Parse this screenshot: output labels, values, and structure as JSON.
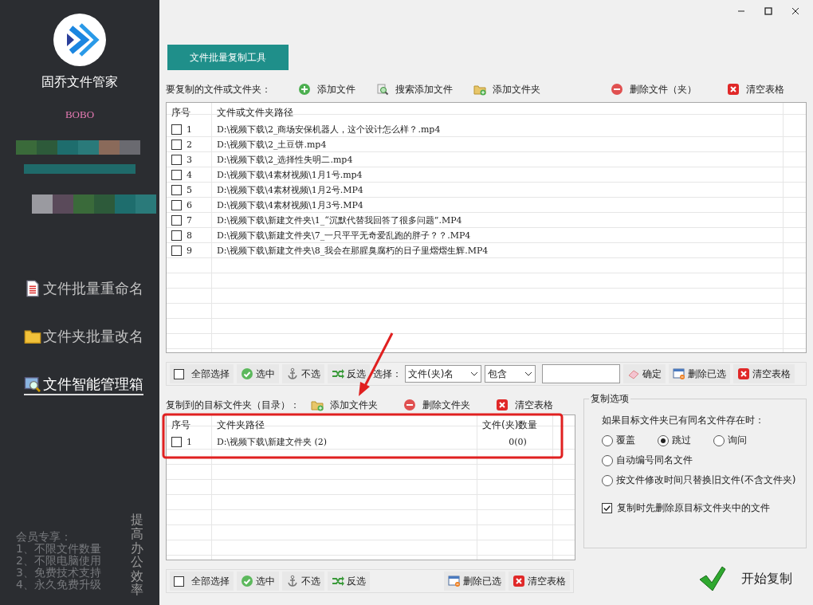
{
  "sidebar": {
    "app_name": "固乔文件管家",
    "user": "BOBO",
    "nav_items": [
      {
        "label": "文件批量重命名",
        "selected": false
      },
      {
        "label": "文件夹批量改名",
        "selected": false
      },
      {
        "label": "文件智能管理箱",
        "selected": true
      }
    ],
    "promo_title": "会员专享：",
    "promo_lines": [
      "1、不限文件数量",
      "2、不限电脑使用",
      "3、免费技术支持",
      "4、永久免费升级"
    ],
    "slogan": "提高办公效率"
  },
  "tab": {
    "label": "文件批量复制工具",
    "selected": true
  },
  "source": {
    "label": "要复制的文件或文件夹：",
    "actions": [
      "添加文件",
      "搜索添加文件",
      "添加文件夹",
      "删除文件（夹）",
      "清空表格"
    ],
    "table": {
      "columns": [
        "序号",
        "文件或文件夹路径"
      ],
      "rows": [
        {
          "index": "1",
          "path": "D:\\视频下载\\2_商场安保机器人，这个设计怎么样？.mp4",
          "checked": false
        },
        {
          "index": "2",
          "path": "D:\\视频下载\\2_土豆饼.mp4",
          "checked": false
        },
        {
          "index": "3",
          "path": "D:\\视频下载\\2_选择性失明二.mp4",
          "checked": false
        },
        {
          "index": "4",
          "path": "D:\\视频下载\\4素材视频\\1月1号.mp4",
          "checked": false
        },
        {
          "index": "5",
          "path": "D:\\视频下载\\4素材视频\\1月2号.MP4",
          "checked": false
        },
        {
          "index": "6",
          "path": "D:\\视频下载\\4素材视频\\1月3号.MP4",
          "checked": false
        },
        {
          "index": "7",
          "path": "D:\\视频下载\\新建文件夹\\1_“沉默代替我回答了很多问题”.MP4",
          "checked": false
        },
        {
          "index": "8",
          "path": "D:\\视频下载\\新建文件夹\\7_一只平平无奇爱乱跑的胖子？？.MP4",
          "checked": false
        },
        {
          "index": "9",
          "path": "D:\\视频下载\\新建文件夹\\8_我会在那腥臭腐朽的日子里熠熠生辉.MP4",
          "checked": false
        }
      ]
    },
    "toolbar": {
      "select_all": {
        "label": "全部选择",
        "checked": false
      },
      "buttons": [
        "选中",
        "不选",
        "反选"
      ],
      "filter_label": "选择：",
      "filter_field": "文件(夹)名",
      "filter_mode": "包含",
      "confirm": "确定",
      "right_buttons": [
        "删除已选",
        "清空表格"
      ]
    }
  },
  "target": {
    "label": "复制到的目标文件夹（目录）：",
    "actions": [
      "添加文件夹",
      "删除文件夹",
      "清空表格"
    ],
    "table": {
      "columns": [
        "序号",
        "文件夹路径",
        "文件(夹)数量"
      ],
      "rows": [
        {
          "index": "1",
          "path": "D:\\视频下载\\新建文件夹 (2)",
          "count": "0(0)",
          "checked": false
        }
      ]
    },
    "toolbar": {
      "select_all": {
        "label": "全部选择",
        "checked": false
      },
      "buttons": [
        "选中",
        "不选",
        "反选"
      ],
      "right_buttons": [
        "删除已选",
        "清空表格"
      ]
    }
  },
  "options": {
    "title": "复制选项",
    "prompt": "如果目标文件夹已有同名文件存在时：",
    "radios": [
      {
        "label": "覆盖",
        "selected": false
      },
      {
        "label": "跳过",
        "selected": true
      },
      {
        "label": "询问",
        "selected": false
      }
    ],
    "extra_radios": [
      {
        "label": "自动编号同名文件",
        "selected": false
      },
      {
        "label": "按文件修改时间只替换旧文件(不含文件夹)",
        "selected": false
      }
    ],
    "checkbox": {
      "label": "复制时先删除原目标文件夹中的文件",
      "checked": true
    }
  },
  "start_button": {
    "label": "开始复制"
  }
}
